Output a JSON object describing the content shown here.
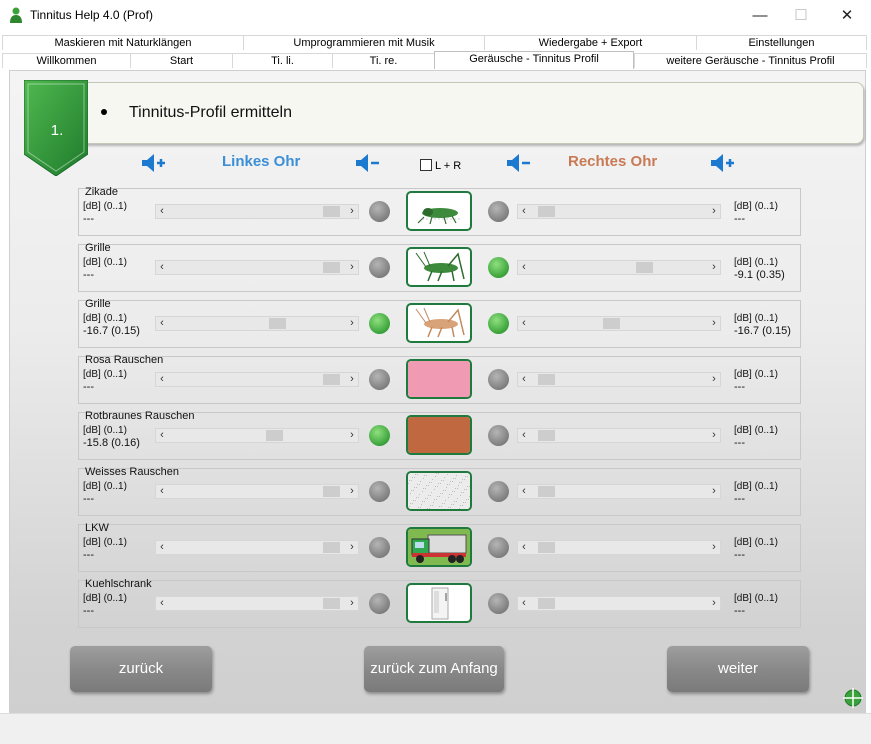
{
  "window": {
    "title": "Tinnitus Help 4.0 (Prof)",
    "minimize": "—",
    "maximize": "☐",
    "close": "✕"
  },
  "tabs_row1": [
    {
      "label": "Maskieren mit Naturklängen"
    },
    {
      "label": "Umprogrammieren mit Musik"
    },
    {
      "label": "Wiedergabe + Export"
    },
    {
      "label": "Einstellungen"
    }
  ],
  "tabs_row2": [
    {
      "label": "Willkommen"
    },
    {
      "label": "Start"
    },
    {
      "label": "Ti. li."
    },
    {
      "label": "Ti. re."
    },
    {
      "label": "Geräusche - Tinnitus Profil",
      "active": true
    },
    {
      "label": "weitere Geräusche - Tinnitus Profil"
    }
  ],
  "step": {
    "number": "1.",
    "heading": "Tinnitus-Profil ermitteln"
  },
  "ears": {
    "left": "Linkes Ohr",
    "right": "Rechtes Ohr",
    "lr_label": "L + R",
    "left_color": "#3b8fd6",
    "right_color": "#c87a55"
  },
  "colors": {
    "accent_green": "#1f7a3d",
    "led_on": "#3aa23a",
    "led_off": "#8a8a8a"
  },
  "rows": [
    {
      "name": "Zikade",
      "unit_l": "[dB] (0..1)",
      "value_l": "---",
      "unit_r": "[dB] (0..1)",
      "value_r": "---",
      "led_l": "off",
      "led_r": "off",
      "pos_l": 0.95,
      "pos_r": 0.05,
      "image": "cicada-icon"
    },
    {
      "name": "Grille",
      "unit_l": "[dB] (0..1)",
      "value_l": "---",
      "unit_r": "[dB] (0..1)",
      "value_r": "-9.1 (0.35)",
      "led_l": "off",
      "led_r": "on",
      "pos_l": 0.95,
      "pos_r": 0.65,
      "image": "cricket-green-icon"
    },
    {
      "name": "Grille",
      "unit_l": "[dB] (0..1)",
      "value_l": "-16.7 (0.15)",
      "unit_r": "[dB] (0..1)",
      "value_r": "-16.7 (0.15)",
      "led_l": "on",
      "led_r": "on",
      "pos_l": 0.62,
      "pos_r": 0.45,
      "image": "cricket-tan-icon"
    },
    {
      "name": "Rosa Rauschen",
      "unit_l": "[dB] (0..1)",
      "value_l": "---",
      "unit_r": "[dB] (0..1)",
      "value_r": "---",
      "led_l": "off",
      "led_r": "off",
      "pos_l": 0.95,
      "pos_r": 0.05,
      "image": "pink-noise-swatch",
      "swatch": "#f09ab4"
    },
    {
      "name": "Rotbraunes Rauschen",
      "unit_l": "[dB] (0..1)",
      "value_l": "-15.8 (0.16)",
      "unit_r": "[dB] (0..1)",
      "value_r": "---",
      "led_l": "on",
      "led_r": "off",
      "pos_l": 0.6,
      "pos_r": 0.05,
      "image": "brown-noise-swatch",
      "swatch": "#c0683f"
    },
    {
      "name": "Weisses Rauschen",
      "unit_l": "[dB] (0..1)",
      "value_l": "---",
      "unit_r": "[dB] (0..1)",
      "value_r": "---",
      "led_l": "off",
      "led_r": "off",
      "pos_l": 0.95,
      "pos_r": 0.05,
      "image": "white-noise-swatch",
      "swatch": "#ececec"
    },
    {
      "name": "LKW",
      "unit_l": "[dB] (0..1)",
      "value_l": "---",
      "unit_r": "[dB] (0..1)",
      "value_r": "---",
      "led_l": "off",
      "led_r": "off",
      "pos_l": 0.95,
      "pos_r": 0.05,
      "image": "truck-icon"
    },
    {
      "name": "Kuehlschrank",
      "unit_l": "[dB] (0..1)",
      "value_l": "---",
      "unit_r": "[dB] (0..1)",
      "value_r": "---",
      "led_l": "off",
      "led_r": "off",
      "pos_l": 0.95,
      "pos_r": 0.05,
      "image": "fridge-icon"
    }
  ],
  "buttons": {
    "back": "zurück",
    "to_start": "zurück zum Anfang",
    "next": "weiter"
  }
}
